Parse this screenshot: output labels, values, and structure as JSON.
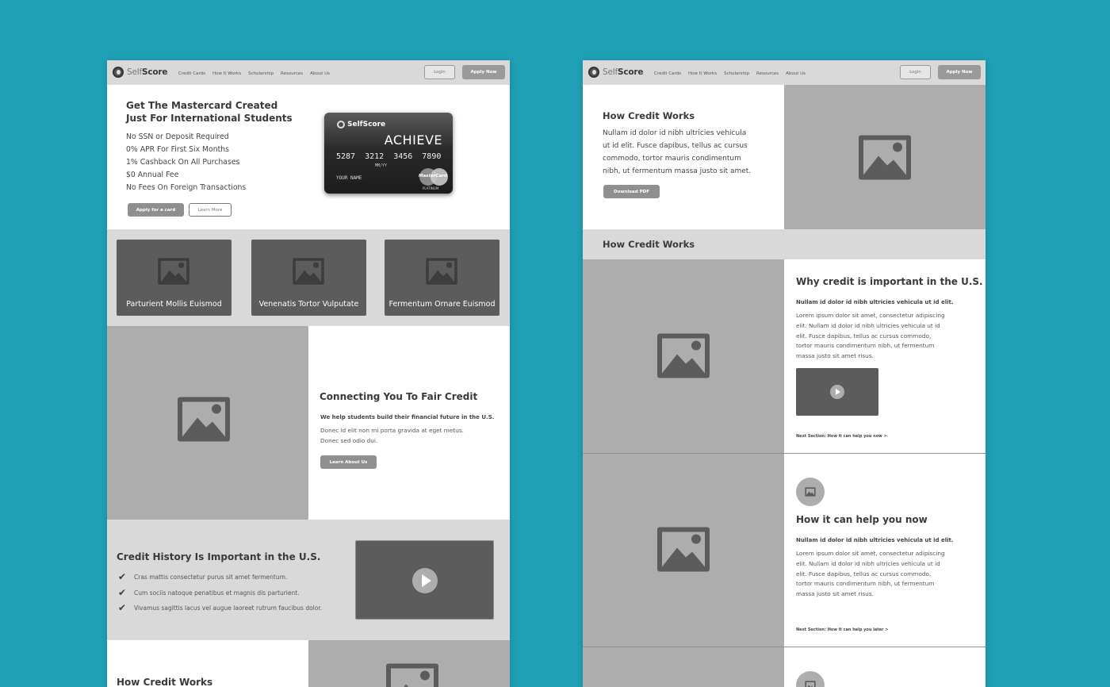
{
  "brand": {
    "name_light": "Self",
    "name_bold": "Score"
  },
  "nav": {
    "links": [
      "Credit Cards",
      "How It Works",
      "Scholarship",
      "Resources",
      "About Us"
    ],
    "login_label": "Login",
    "apply_label": "Apply Now"
  },
  "left": {
    "hero": {
      "title_line1": "Get The Mastercard Created",
      "title_line2": "Just For International Students",
      "features": [
        "No SSN or Deposit Required",
        "0% APR For First Six Months",
        "1% Cashback On All Purchases",
        "$0 Annual Fee",
        "No Fees On Foreign Transactions"
      ],
      "apply_button": "Apply for a card",
      "learn_button": "Learn More",
      "card": {
        "brand": "SelfScore",
        "product": "ACHIEVE",
        "number": [
          "5287",
          "3212",
          "3456",
          "7890"
        ],
        "expiry": "MM/YY",
        "holder": "YOUR NAME",
        "network": "MasterCard",
        "tier": "PLATINUM"
      }
    },
    "tiles": [
      "Parturient Mollis Euismod",
      "Venenatis Tortor Vulputate",
      "Fermentum Ornare Euismod"
    ],
    "connect": {
      "title": "Connecting You To Fair Credit",
      "subtitle": "We help students build their financial future in the U.S.",
      "body_line1": "Donec id elit non mi porta gravida at eget metus.",
      "body_line2": "Donec sed odio dui.",
      "button": "Learn About Us"
    },
    "history": {
      "title": "Credit History Is Important in the U.S.",
      "checks": [
        "Cras mattis consectetur purus sit amet fermentum.",
        "Cum sociis natoque penatibus et magnis dis parturient.",
        "Vivamus sagittis lacus vel augue laoreet rutrum faucibus dolor."
      ]
    },
    "how_title": "How Credit Works"
  },
  "right": {
    "intro": {
      "title": "How Credit Works",
      "body": [
        "Nullam id dolor id nibh ultricies vehicula",
        "ut id elit. Fusce dapibus, tellus ac cursus",
        "commodo, tortor mauris condimentum",
        "nibh, ut fermentum massa justo sit amet."
      ],
      "button": "Download PDF"
    },
    "band_title": "How Credit Works",
    "section1": {
      "title": "Why credit is important in the U.S.",
      "lead": "Nullam id dolor id nibh ultricies vehicula ut id elit.",
      "body": [
        "Lorem ipsum dolor sit amet, consectetur adipiscing",
        "elit. Nullam id dolor id nibh ultricies vehicula ut id",
        "elit. Fusce dapibus, tellus ac cursus commodo,",
        "tortor mauris condimentum nibh, ut fermentum",
        "massa justo sit amet risus."
      ],
      "next": "Next Section: How it can help you now >"
    },
    "section2": {
      "title": "How it can help you now",
      "lead": "Nullam id dolor id nibh ultricies vehicula ut id elit.",
      "body": [
        "Lorem ipsum dolor sit amet, consectetur adipiscing",
        "elit. Nullam id dolor id nibh ultricies vehicula ut id",
        "elit. Fusce dapibus, tellus ac cursus commodo,",
        "tortor mauris condimentum nibh, ut fermentum",
        "massa justo sit amet risus."
      ],
      "next": "Next Section: How it can help you later >"
    }
  }
}
